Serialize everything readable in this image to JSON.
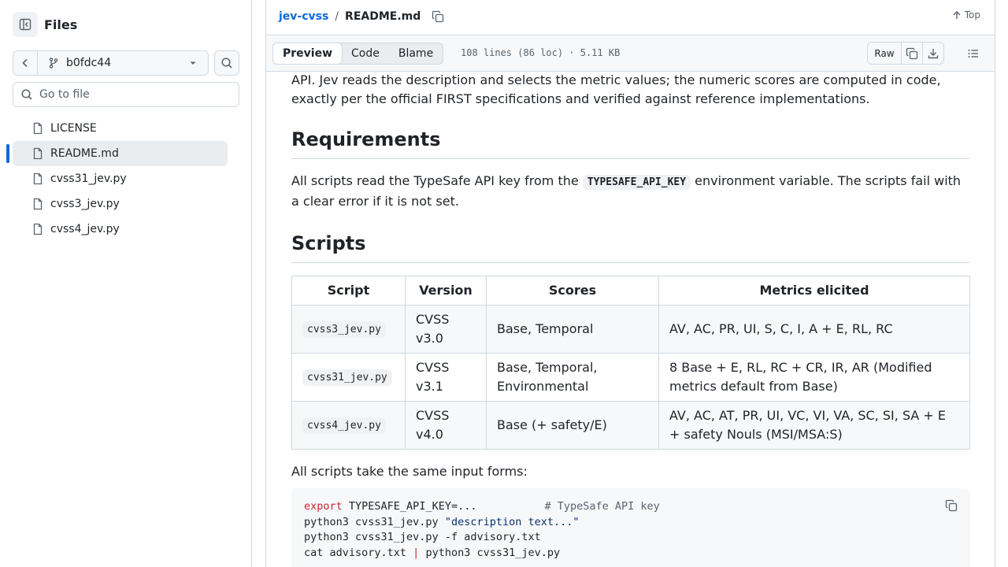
{
  "sidebar": {
    "title": "Files",
    "branch": "b0fdc44",
    "goto_placeholder": "Go to file",
    "files": [
      {
        "name": "LICENSE",
        "active": false
      },
      {
        "name": "README.md",
        "active": true
      },
      {
        "name": "cvss31_jev.py",
        "active": false
      },
      {
        "name": "cvss3_jev.py",
        "active": false
      },
      {
        "name": "cvss4_jev.py",
        "active": false
      }
    ]
  },
  "header": {
    "repo": "jev-cvss",
    "separator": "/",
    "file": "README.md",
    "top_label": "Top"
  },
  "file_bar": {
    "tabs": [
      "Preview",
      "Code",
      "Blame"
    ],
    "active_tab": "Preview",
    "meta": "108 lines (86 loc) · 5.11 KB",
    "raw_label": "Raw"
  },
  "readme": {
    "intro_line1": "API. Jev reads the description and selects the metric values; the numeric scores are computed in code,",
    "intro_line2": "exactly per the official FIRST specifications and verified against reference implementations.",
    "requirements_heading": "Requirements",
    "req_text_before": "All scripts read the TypeSafe API key from the ",
    "req_env_var": "TYPESAFE_API_KEY",
    "req_text_after": " environment variable. The scripts fail with",
    "req_text_line2": "a clear error if it is not set.",
    "scripts_heading": "Scripts",
    "table": {
      "headers": [
        "Script",
        "Version",
        "Scores",
        "Metrics elicited"
      ],
      "rows": [
        {
          "script": "cvss3_jev.py",
          "version_1": "CVSS",
          "version_2": "v3.0",
          "scores_1": "Base, Temporal",
          "scores_2": "",
          "metrics_1": "AV, AC, PR, UI, S, C, I, A + E, RL, RC",
          "metrics_2": ""
        },
        {
          "script": "cvss31_jev.py",
          "version_1": "CVSS",
          "version_2": "v3.1",
          "scores_1": "Base, Temporal,",
          "scores_2": "Environmental",
          "metrics_1": "8 Base + E, RL, RC + CR, IR, AR (Modified",
          "metrics_2": "metrics default from Base)"
        },
        {
          "script": "cvss4_jev.py",
          "version_1": "CVSS",
          "version_2": "v4.0",
          "scores_1": "Base (+ safety/E)",
          "scores_2": "",
          "metrics_1": "AV, AC, AT, PR, UI, VC, VI, VA, SC, SI, SA + E",
          "metrics_2": "+ safety Nouls (MSI/MSA:S)"
        }
      ]
    },
    "input_forms_text": "All scripts take the same input forms:",
    "code": {
      "l1_kw": "export",
      "l1_rest": " TYPESAFE_API_KEY=...",
      "l1_comment": "# TypeSafe API key",
      "l2_cmd": "python3 cvss31_jev.py ",
      "l2_str": "\"description text...\"",
      "l3": "python3 cvss31_jev.py -f advisory.txt",
      "l4_a": "cat advisory.txt ",
      "l4_pipe": "|",
      "l4_b": " python3 cvss31_jev.py"
    }
  }
}
